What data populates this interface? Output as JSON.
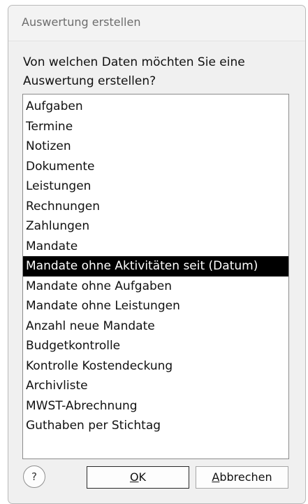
{
  "dialog": {
    "title": "Auswertung erstellen",
    "prompt": "Von welchen Daten möchten Sie eine Auswertung erstellen?"
  },
  "list": {
    "selected_index": 8,
    "items": [
      "Aufgaben",
      "Termine",
      "Notizen",
      "Dokumente",
      "Leistungen",
      "Rechnungen",
      "Zahlungen",
      "Mandate",
      "Mandate ohne Aktivitäten seit (Datum)",
      "Mandate ohne Aufgaben",
      "Mandate ohne Leistungen",
      "Anzahl neue Mandate",
      "Budgetkontrolle",
      "Kontrolle Kostendeckung",
      "Archivliste",
      "MWST-Abrechnung",
      "Guthaben per Stichtag"
    ]
  },
  "buttons": {
    "help_label": "?",
    "ok_mnemonic": "O",
    "ok_rest": "K",
    "cancel_mnemonic": "A",
    "cancel_rest": "bbrechen"
  },
  "colors": {
    "selection_bg": "#000000",
    "selection_fg": "#ffffff",
    "dialog_bg": "#f0f0f0"
  }
}
